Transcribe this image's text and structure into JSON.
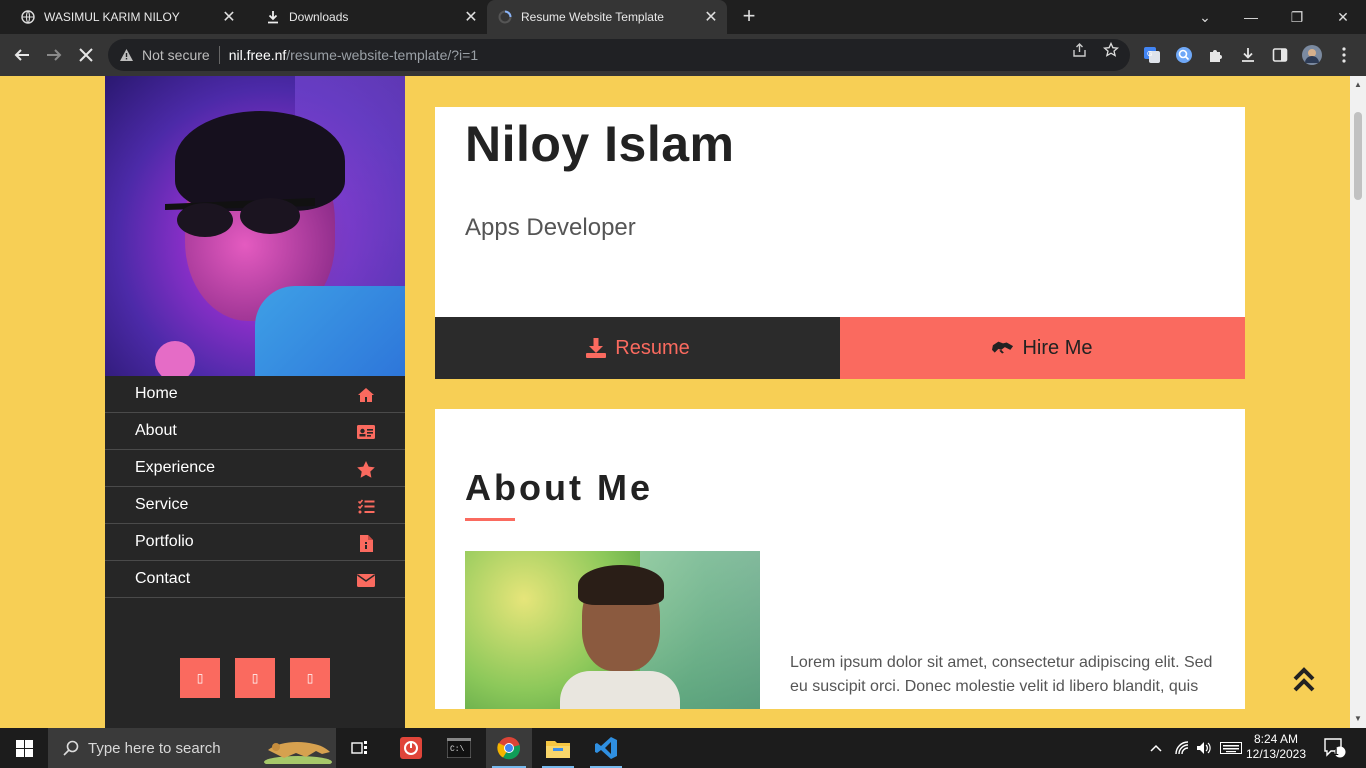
{
  "browser": {
    "tabs": [
      {
        "title": "WASIMUL KARIM NILOY",
        "active": false,
        "icon": "globe-icon"
      },
      {
        "title": "Downloads",
        "active": false,
        "icon": "download-icon"
      },
      {
        "title": "Resume Website Template",
        "active": true,
        "icon": "loading-icon"
      }
    ],
    "security_label": "Not secure",
    "url_host": "nil.free.nf",
    "url_path": "/resume-website-template/?i=1"
  },
  "site": {
    "menu": [
      {
        "label": "Home",
        "icon": "home-icon"
      },
      {
        "label": "About",
        "icon": "id-card-icon"
      },
      {
        "label": "Experience",
        "icon": "star-icon"
      },
      {
        "label": "Service",
        "icon": "task-list-icon"
      },
      {
        "label": "Portfolio",
        "icon": "file-icon"
      },
      {
        "label": "Contact",
        "icon": "envelope-icon"
      }
    ],
    "social": [
      "social-icon",
      "social-icon",
      "social-icon"
    ],
    "name": "Niloy Islam",
    "role": "Apps Developer",
    "resume_label": "Resume",
    "hire_label": "Hire Me",
    "about_title": "About Me",
    "about_text": "Lorem ipsum dolor sit amet, consectetur adipiscing elit. Sed eu suscipit orci. Donec molestie velit id libero blandit, quis"
  },
  "taskbar": {
    "search_placeholder": "Type here to search",
    "time": "8:24 AM",
    "date": "12/13/2023",
    "notification_count": "1"
  },
  "colors": {
    "page_bg": "#f7cf55",
    "accent": "#fa6a5f",
    "sidebar_bg": "#262626",
    "dark_button": "#2b2b2b"
  }
}
